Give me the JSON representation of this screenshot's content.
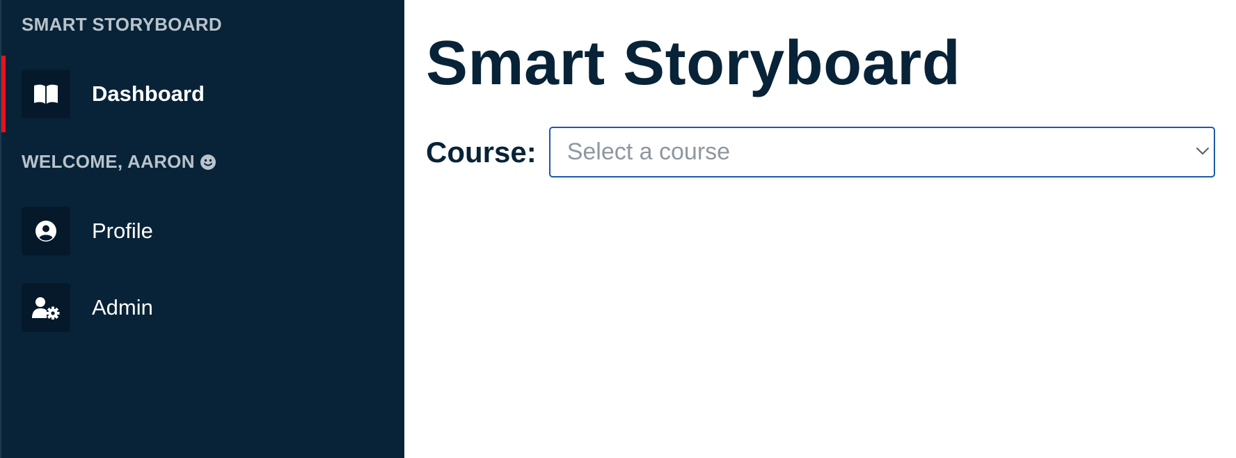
{
  "sidebar": {
    "brand_heading": "SMART STORYBOARD",
    "welcome_heading": "WELCOME, AARON",
    "items": [
      {
        "label": "Dashboard",
        "icon": "book-open-icon",
        "active": true
      },
      {
        "label": "Profile",
        "icon": "user-circle-icon",
        "active": false
      },
      {
        "label": "Admin",
        "icon": "user-gear-icon",
        "active": false
      }
    ]
  },
  "main": {
    "title": "Smart Storyboard",
    "course_label": "Course:",
    "course_select": {
      "placeholder": "Select a course",
      "value": ""
    }
  },
  "colors": {
    "sidebar_bg": "#082337",
    "active_indicator": "#e8121f",
    "title_text": "#082337",
    "select_border": "#1a5aa8"
  }
}
